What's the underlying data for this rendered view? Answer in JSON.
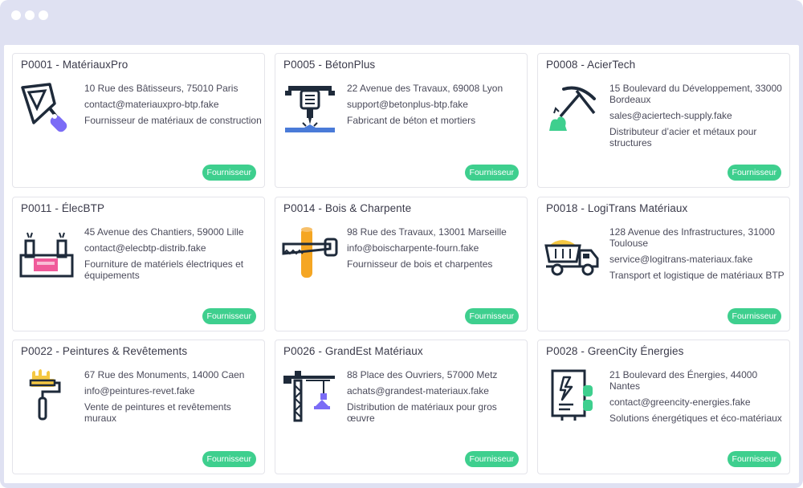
{
  "colors": {
    "frame": "#dfe1f2",
    "badge": "#3ecf8e",
    "title_text": "#3a3a4a",
    "body_text": "#4a4a5a",
    "icon_dark": "#1e2a3a",
    "icon_purple": "#7b6cf6",
    "icon_blue": "#4a7bd8",
    "icon_green": "#3ecf8e",
    "icon_pink": "#f05a9a",
    "icon_orange": "#f5a623",
    "icon_yellow": "#f5c842"
  },
  "cards": [
    {
      "title": "P0001 - MatériauxPro",
      "icon": "trowel-icon",
      "address": "10 Rue des Bâtisseurs, 75010 Paris",
      "email": "contact@materiauxpro-btp.fake",
      "description": "Fournisseur de matériaux de construction",
      "badge": "Fournisseur"
    },
    {
      "title": "P0005 - BétonPlus",
      "icon": "jackhammer-icon",
      "address": "22 Avenue des Travaux, 69008 Lyon",
      "email": "support@betonplus-btp.fake",
      "description": "Fabricant de béton et mortiers",
      "badge": "Fournisseur"
    },
    {
      "title": "P0008 - AcierTech",
      "icon": "pickaxe-icon",
      "address": "15 Boulevard du Développement, 33000 Bordeaux",
      "email": "sales@aciertech-supply.fake",
      "description": "Distributeur d’acier et métaux pour structures",
      "badge": "Fournisseur"
    },
    {
      "title": "P0011 - ÉlecBTP",
      "icon": "factory-icon",
      "address": "45 Avenue des Chantiers, 59000 Lille",
      "email": "contact@elecbtp-distrib.fake",
      "description": "Fourniture de matériels électriques et équipements",
      "badge": "Fournisseur"
    },
    {
      "title": "P0014 - Bois & Charpente",
      "icon": "saw-log-icon",
      "address": "98 Rue des Travaux, 13001 Marseille",
      "email": "info@boischarpente-fourn.fake",
      "description": "Fournisseur de bois et charpentes",
      "badge": "Fournisseur"
    },
    {
      "title": "P0018 - LogiTrans Matériaux",
      "icon": "dump-truck-icon",
      "address": "128 Avenue des Infrastructures, 31000 Toulouse",
      "email": "service@logitrans-materiaux.fake",
      "description": "Transport et logistique de matériaux BTP",
      "badge": "Fournisseur"
    },
    {
      "title": "P0022 - Peintures & Revêtements",
      "icon": "paint-roller-icon",
      "address": "67 Rue des Monuments, 14000 Caen",
      "email": "info@peintures-revet.fake",
      "description": "Vente de peintures et revêtements muraux",
      "badge": "Fournisseur"
    },
    {
      "title": "P0026 - GrandEst Matériaux",
      "icon": "crane-icon",
      "address": "88 Place des Ouvriers, 57000 Metz",
      "email": "achats@grandest-materiaux.fake",
      "description": "Distribution de matériaux pour gros œuvre",
      "badge": "Fournisseur"
    },
    {
      "title": "P0028 - GreenCity Énergies",
      "icon": "energy-panel-icon",
      "address": "21 Boulevard des Énergies, 44000 Nantes",
      "email": "contact@greencity-energies.fake",
      "description": "Solutions énergétiques et éco-matériaux",
      "badge": "Fournisseur"
    }
  ]
}
